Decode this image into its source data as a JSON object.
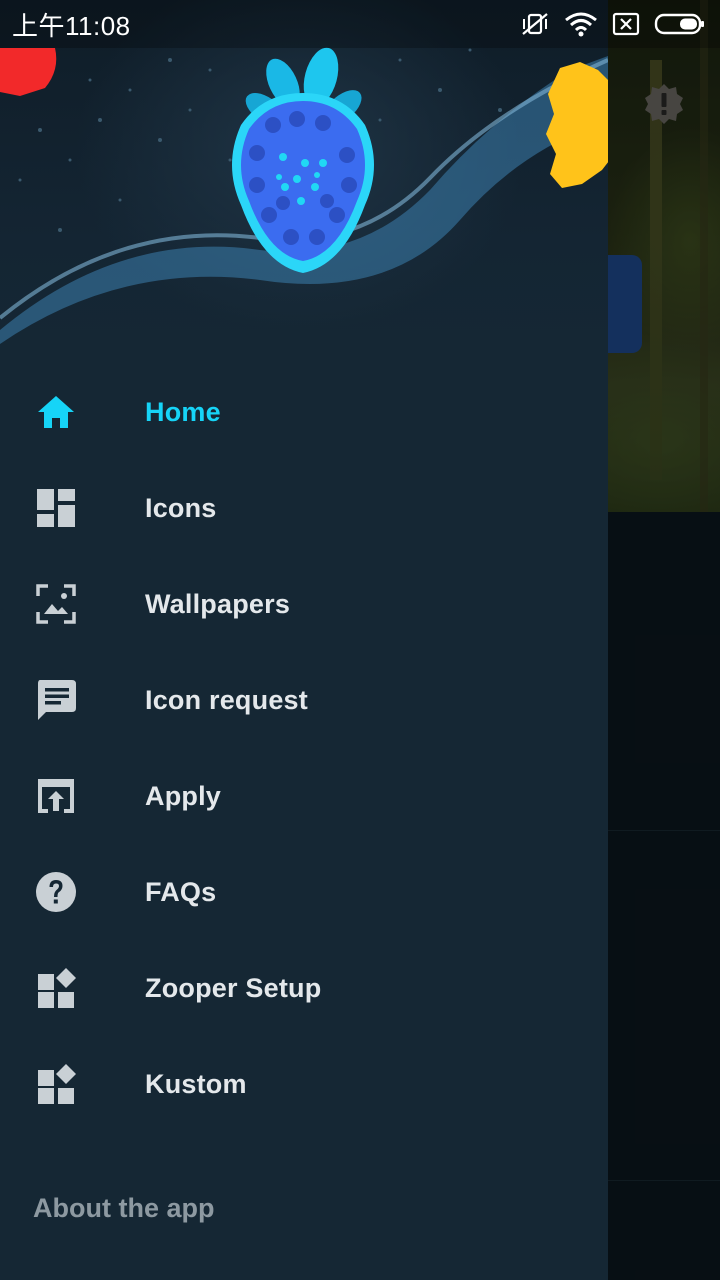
{
  "status_bar": {
    "time": "上午11:08",
    "icons": [
      "vibrate-icon",
      "wifi-icon",
      "sim-x-icon",
      "battery-icon"
    ]
  },
  "drawer": {
    "nav_items": [
      {
        "label": "Home",
        "icon": "home-icon",
        "active": true
      },
      {
        "label": "Icons",
        "icon": "dashboard-icon",
        "active": false
      },
      {
        "label": "Wallpapers",
        "icon": "wallpaper-icon",
        "active": false
      },
      {
        "label": "Icon request",
        "icon": "message-icon",
        "active": false
      },
      {
        "label": "Apply",
        "icon": "open-in-browser-icon",
        "active": false
      },
      {
        "label": "FAQs",
        "icon": "help-icon",
        "active": false
      },
      {
        "label": "Zooper Setup",
        "icon": "widgets-icon",
        "active": false
      },
      {
        "label": "Kustom",
        "icon": "widgets-icon",
        "active": false
      }
    ],
    "about_label": "About the app"
  },
  "colors": {
    "accent": "#16d4f7",
    "drawer_bg": "#152734",
    "icon_gray": "#c9d0d5"
  }
}
